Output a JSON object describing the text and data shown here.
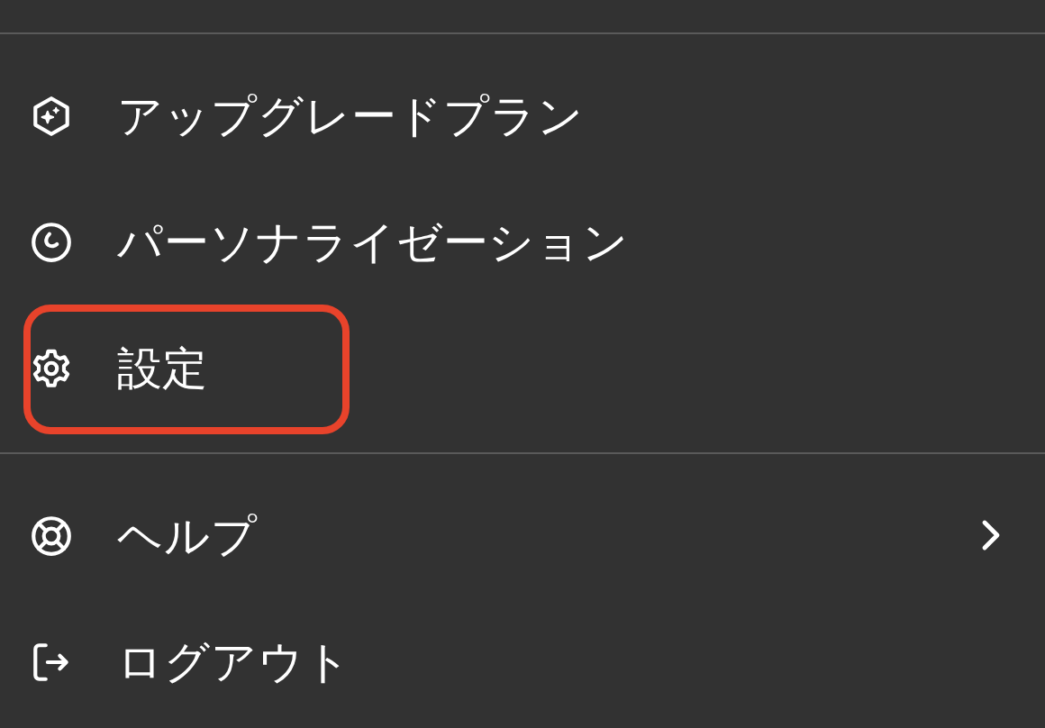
{
  "menu_sections": [
    {
      "items": [
        {
          "kind": "upgrade",
          "label": "アップグレードプラン",
          "has_submenu": false,
          "circled": false
        },
        {
          "kind": "personalize",
          "label": "パーソナライゼーション",
          "has_submenu": false,
          "circled": false
        },
        {
          "kind": "settings",
          "label": "設定",
          "has_submenu": false,
          "circled": true
        }
      ]
    },
    {
      "items": [
        {
          "kind": "help",
          "label": "ヘルプ",
          "has_submenu": true,
          "circled": false
        },
        {
          "kind": "logout",
          "label": "ログアウト",
          "has_submenu": false,
          "circled": false
        }
      ]
    }
  ]
}
